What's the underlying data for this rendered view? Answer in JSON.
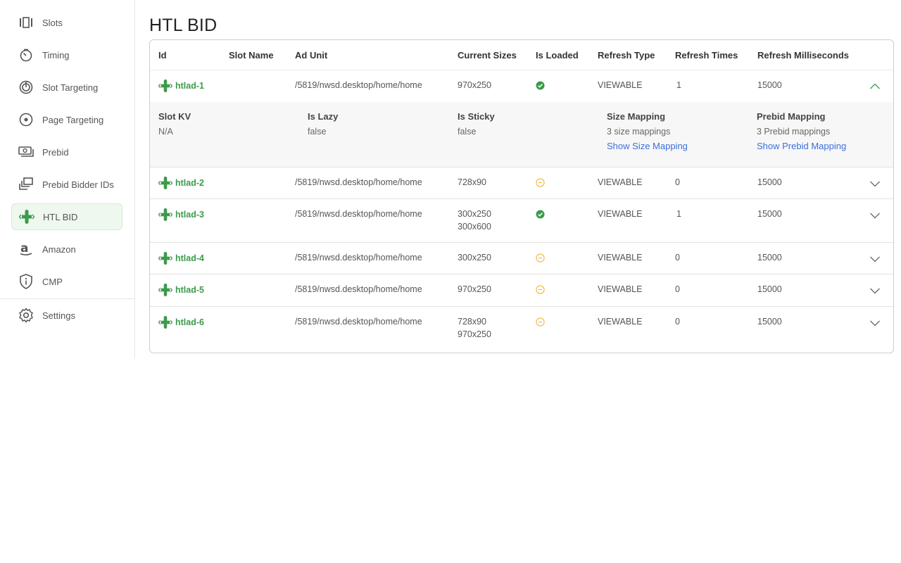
{
  "sidebar": {
    "items": [
      {
        "label": "Slots",
        "icon": "slots-icon"
      },
      {
        "label": "Timing",
        "icon": "timer-icon"
      },
      {
        "label": "Slot Targeting",
        "icon": "target-icon"
      },
      {
        "label": "Page Targeting",
        "icon": "radio-target-icon"
      },
      {
        "label": "Prebid",
        "icon": "money-icon"
      },
      {
        "label": "Prebid Bidder IDs",
        "icon": "stack-icon"
      },
      {
        "label": "HTL BID",
        "icon": "htl-logo-icon",
        "active": true
      },
      {
        "label": "Amazon",
        "icon": "amazon-icon"
      },
      {
        "label": "CMP",
        "icon": "shield-info-icon"
      },
      {
        "label": "Settings",
        "icon": "gear-icon"
      }
    ]
  },
  "page": {
    "title": "HTL BID"
  },
  "table": {
    "headers": {
      "id": "Id",
      "slot_name": "Slot Name",
      "ad_unit": "Ad Unit",
      "current_sizes": "Current Sizes",
      "is_loaded": "Is Loaded",
      "refresh_type": "Refresh Type",
      "refresh_times": "Refresh Times",
      "refresh_ms": "Refresh Milliseconds"
    },
    "rows": [
      {
        "id": "htlad-1",
        "slot_name": "",
        "ad_unit": "/5819/nwsd.desktop/home/home",
        "size1": "970x250",
        "size2": "",
        "loaded": true,
        "refresh_type": "VIEWABLE",
        "refresh_times": "1",
        "refresh_ms": "15000",
        "expanded": true
      },
      {
        "id": "htlad-2",
        "slot_name": "",
        "ad_unit": "/5819/nwsd.desktop/home/home",
        "size1": "728x90",
        "size2": "",
        "loaded": false,
        "refresh_type": "VIEWABLE",
        "refresh_times": "0",
        "refresh_ms": "15000"
      },
      {
        "id": "htlad-3",
        "slot_name": "",
        "ad_unit": "/5819/nwsd.desktop/home/home",
        "size1": "300x250",
        "size2": "300x600",
        "loaded": true,
        "refresh_type": "VIEWABLE",
        "refresh_times": "1",
        "refresh_ms": "15000"
      },
      {
        "id": "htlad-4",
        "slot_name": "",
        "ad_unit": "/5819/nwsd.desktop/home/home",
        "size1": "300x250",
        "size2": "",
        "loaded": false,
        "refresh_type": "VIEWABLE",
        "refresh_times": "0",
        "refresh_ms": "15000"
      },
      {
        "id": "htlad-5",
        "slot_name": "",
        "ad_unit": "/5819/nwsd.desktop/home/home",
        "size1": "970x250",
        "size2": "",
        "loaded": false,
        "refresh_type": "VIEWABLE",
        "refresh_times": "0",
        "refresh_ms": "15000"
      },
      {
        "id": "htlad-6",
        "slot_name": "",
        "ad_unit": "/5819/nwsd.desktop/home/home",
        "size1": "728x90",
        "size2": "970x250",
        "loaded": false,
        "refresh_type": "VIEWABLE",
        "refresh_times": "0",
        "refresh_ms": "15000"
      }
    ],
    "detail": {
      "slot_kv_label": "Slot KV",
      "slot_kv_value": "N/A",
      "is_lazy_label": "Is Lazy",
      "is_lazy_value": "false",
      "is_sticky_label": "Is Sticky",
      "is_sticky_value": "false",
      "size_mapping_label": "Size Mapping",
      "size_mapping_value": "3 size mappings",
      "size_mapping_link": "Show Size Mapping",
      "prebid_mapping_label": "Prebid Mapping",
      "prebid_mapping_value": "3 Prebid mappings",
      "prebid_mapping_link": "Show Prebid Mapping"
    }
  },
  "colors": {
    "accent": "#3c9a4b",
    "loaded": "#3c9a4b",
    "pending": "#f2b740",
    "link": "#3b6fe0"
  }
}
